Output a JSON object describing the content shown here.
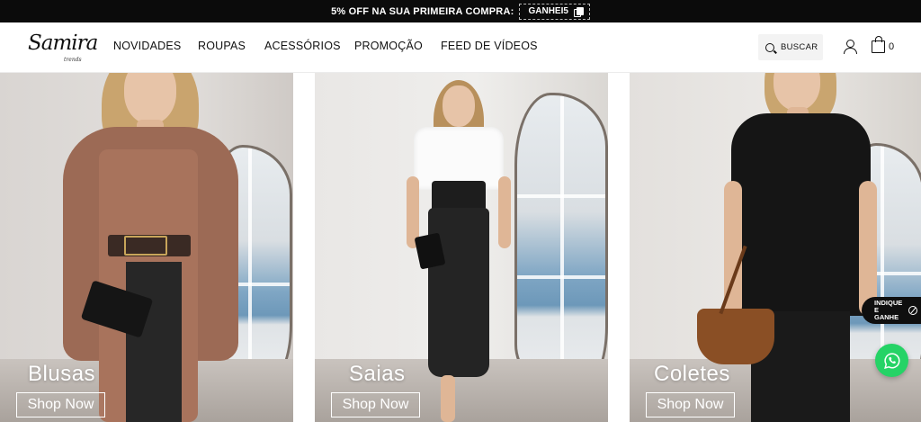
{
  "promo": {
    "text": "5% OFF NA SUA PRIMEIRA COMPRA:",
    "code": "GANHEI5"
  },
  "header": {
    "logo_main": "Samira",
    "logo_sub": "trends",
    "nav": [
      "NOVIDADES",
      "ROUPAS",
      "ACESSÓRIOS",
      "PROMOÇÃO",
      "FEED DE VÍDEOS"
    ],
    "search_label": "BUSCAR",
    "cart_count": "0"
  },
  "banners": [
    {
      "title": "Blusas",
      "button": "Shop Now"
    },
    {
      "title": "Saias",
      "button": "Shop Now"
    },
    {
      "title": "Coletes",
      "button": "Shop Now"
    }
  ],
  "widgets": {
    "indique_line1": "INDIQUE",
    "indique_line2": "E GANHE"
  },
  "colors": {
    "promo_bg": "#0b0b0b",
    "whatsapp": "#25d366"
  }
}
